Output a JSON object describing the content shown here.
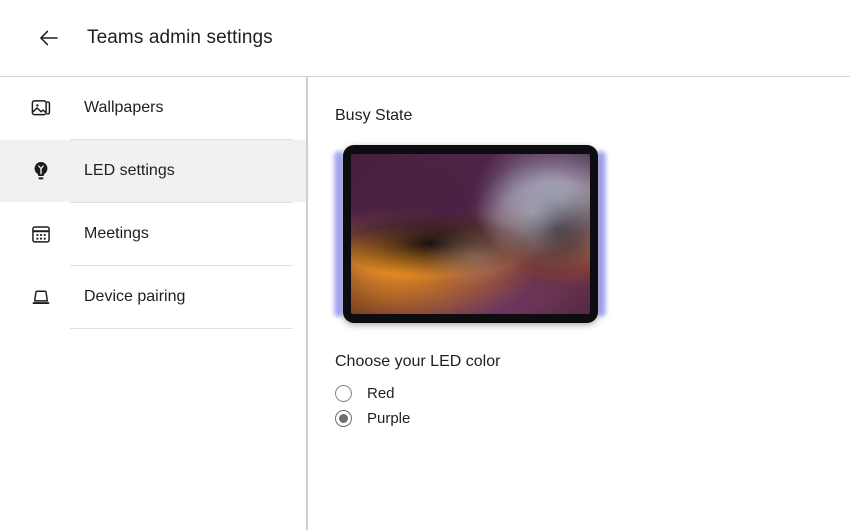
{
  "header": {
    "back_icon": "arrow-left-icon",
    "title": "Teams admin settings"
  },
  "sidebar": {
    "items": [
      {
        "id": "wallpapers",
        "label": "Wallpapers",
        "icon": "image-stack-icon",
        "selected": false
      },
      {
        "id": "led-settings",
        "label": "LED settings",
        "icon": "lightbulb-icon",
        "selected": true
      },
      {
        "id": "meetings",
        "label": "Meetings",
        "icon": "calendar-icon",
        "selected": false
      },
      {
        "id": "device-pairing",
        "label": "Device pairing",
        "icon": "device-icon",
        "selected": false
      }
    ]
  },
  "main": {
    "section_title": "Busy State",
    "device_preview": {
      "name": "tablet-busy-state-preview",
      "led_glow_color": "#a3a5f5",
      "bezel_color": "#0d0d0f"
    },
    "led_color_group": {
      "legend": "Choose your LED color",
      "options": [
        {
          "id": "red",
          "label": "Red",
          "checked": false
        },
        {
          "id": "purple",
          "label": "Purple",
          "checked": true
        }
      ]
    }
  },
  "colors": {
    "divider": "#e2e2e2",
    "header_border": "#d6d6d6",
    "sidebar_border": "#cfcfcf",
    "selected_row": "#f1f1f1",
    "text": "#1f1f1f",
    "radio_gray": "#6e6e6e"
  }
}
